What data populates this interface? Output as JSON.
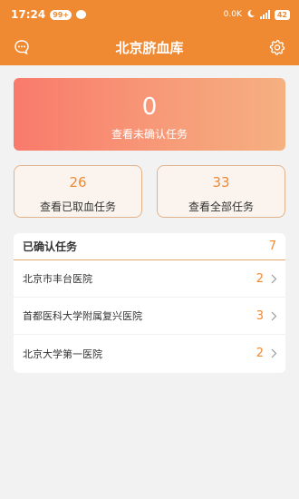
{
  "status_bar": {
    "time": "17:24",
    "notif_badge": "99+",
    "net_speed": "0.0K",
    "battery": "42"
  },
  "header": {
    "title": "北京脐血库"
  },
  "hero": {
    "count": "0",
    "label": "查看未确认任务"
  },
  "cards": [
    {
      "count": "26",
      "label": "查看已取血任务"
    },
    {
      "count": "33",
      "label": "查看全部任务"
    }
  ],
  "confirmed": {
    "title": "已确认任务",
    "total": "7",
    "hospitals": [
      {
        "name": "北京市丰台医院",
        "count": "2"
      },
      {
        "name": "首都医科大学附属复兴医院",
        "count": "3"
      },
      {
        "name": "北京大学第一医院",
        "count": "2"
      }
    ]
  },
  "colors": {
    "accent": "#ef8a33",
    "hero_gradient_start": "#f97a6b",
    "hero_gradient_end": "#f5b080"
  }
}
